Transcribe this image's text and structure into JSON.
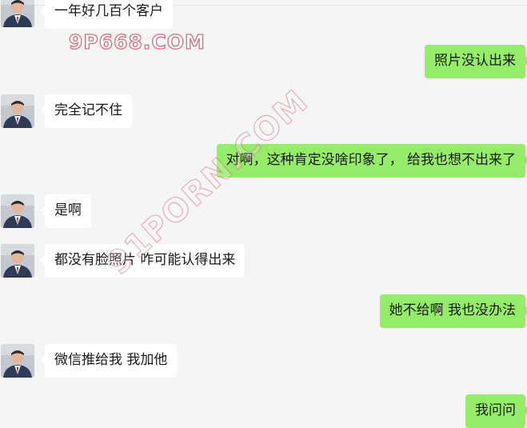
{
  "watermarks": {
    "top": "9P668.COM",
    "diagonal": "91PORN.COM"
  },
  "colors": {
    "background": "#f5f5f5",
    "incoming_bubble": "#ffffff",
    "outgoing_bubble": "#95ec69",
    "text": "#191919"
  },
  "messages": [
    {
      "direction": "in",
      "text": "一年好几百个客户"
    },
    {
      "direction": "out",
      "text": "照片没认出来"
    },
    {
      "direction": "in",
      "text": "完全记不住"
    },
    {
      "direction": "out",
      "text": "对啊，这种肯定没啥印象了， 给我也想不出来了"
    },
    {
      "direction": "in",
      "text": "是啊"
    },
    {
      "direction": "in",
      "text": "都没有脸照片 咋可能认得出来"
    },
    {
      "direction": "out",
      "text": "她不给啊 我也没办法"
    },
    {
      "direction": "in",
      "text": "微信推给我 我加他"
    },
    {
      "direction": "out",
      "text": "我问问"
    }
  ]
}
